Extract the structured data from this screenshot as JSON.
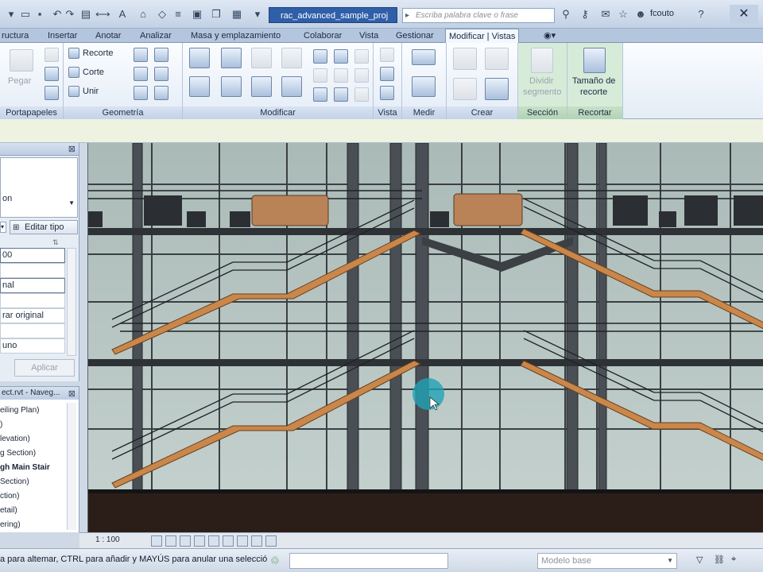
{
  "title_bar": {
    "document_title": "rac_advanced_sample_proj",
    "search_placeholder": "Escriba palabra clave o frase",
    "search_lead_icon": "▸",
    "user": "fcouto",
    "quick_access_icons": [
      "open-icon",
      "save-icon",
      "undo-icon",
      "redo-icon",
      "print-icon",
      "measure-icon",
      "text-icon",
      "default-3d-view-icon",
      "section-icon",
      "thin-lines-icon",
      "close-hidden-windows-icon",
      "switch-windows-icon",
      "customize-icon"
    ],
    "close_glyph": "✕"
  },
  "ribbon_tabs": [
    {
      "label": "ructura",
      "active": false
    },
    {
      "label": "Insertar",
      "active": false
    },
    {
      "label": "Anotar",
      "active": false
    },
    {
      "label": "Analizar",
      "active": false
    },
    {
      "label": "Masa y emplazamiento",
      "active": false
    },
    {
      "label": "Colaborar",
      "active": false
    },
    {
      "label": "Vista",
      "active": false
    },
    {
      "label": "Gestionar",
      "active": false
    },
    {
      "label": "Modificar | Vistas",
      "active": true
    }
  ],
  "ribbon": {
    "portapapeles": {
      "title": "Portapapeles",
      "paste_label": "Pegar"
    },
    "geometria": {
      "title": "Geometría",
      "recorte_label": "Recorte",
      "corte_label": "Corte",
      "unir_label": "Unir"
    },
    "modificar": {
      "title": "Modificar"
    },
    "vista": {
      "title": "Vista"
    },
    "medir": {
      "title": "Medir"
    },
    "crear": {
      "title": "Crear"
    },
    "seccion": {
      "title": "Sección",
      "dividir_line1": "Dividir",
      "dividir_line2": "segmento"
    },
    "recortar": {
      "title": "Recortar",
      "tamano_line1": "Tamaño de",
      "tamano_line2": "recorte"
    }
  },
  "properties_panel": {
    "type_text": "on",
    "edit_type_label": "Editar tipo",
    "rows": [
      "00",
      "",
      "nal",
      "",
      "rar original",
      "",
      "uno"
    ],
    "apply_label": "Aplicar"
  },
  "project_browser": {
    "header": "ect.rvt - Naveg...",
    "items": [
      {
        "label": "eiling Plan)",
        "bold": false
      },
      {
        "label": ")",
        "bold": false
      },
      {
        "label": "levation)",
        "bold": false
      },
      {
        "label": "g Section)",
        "bold": false
      },
      {
        "label": "gh Main Stair",
        "bold": true
      },
      {
        "label": "Section)",
        "bold": false
      },
      {
        "label": "ction)",
        "bold": false
      },
      {
        "label": "etail)",
        "bold": false
      },
      {
        "label": "ering)",
        "bold": false
      }
    ]
  },
  "view_control_bar": {
    "scale": "1 : 100"
  },
  "status_bar": {
    "hint": "a para altemar, CTRL para añadir y MAYÚS para anular una selecció",
    "model_select": "Modelo base"
  },
  "colors": {
    "title_active": "#2f5fa8",
    "canvas_bg": "#b7c6c2",
    "stair_tread": "#c9874b",
    "railing": "#2a2e33",
    "floor_slab": "#2b1e19",
    "cursor_highlight": "#21a3b5"
  }
}
